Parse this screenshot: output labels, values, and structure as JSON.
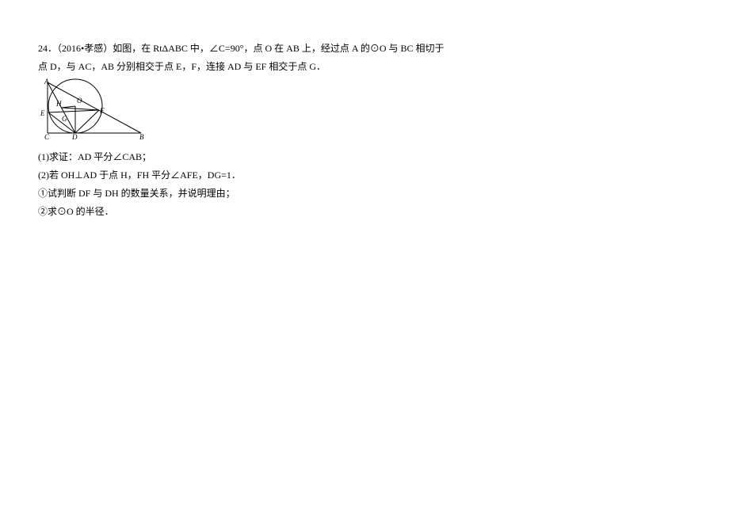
{
  "problem": {
    "number_year": "24．（2016•孝感）如图，在 RtΔABC 中，∠C=90°，点 O 在 AB 上，经过点 A 的⊙O 与 BC 相切于",
    "line2": "点 D，与 AC，AB 分别相交于点 E，F，连接 AD 与 EF 相交于点 G．",
    "q1": "(1)求证：AD 平分∠CAB；",
    "q2": "(2)若 OH⊥AD 于点 H，FH 平分∠AFE，DG=1．",
    "q2a": "①试判断 DF 与 DH 的数量关系，并说明理由；",
    "q2b": "②求⊙O 的半径．"
  },
  "figure": {
    "labels": {
      "A": "A",
      "B": "B",
      "C": "C",
      "D": "D",
      "E": "E",
      "F": "F",
      "G": "G",
      "H": "H",
      "O": "O"
    }
  }
}
